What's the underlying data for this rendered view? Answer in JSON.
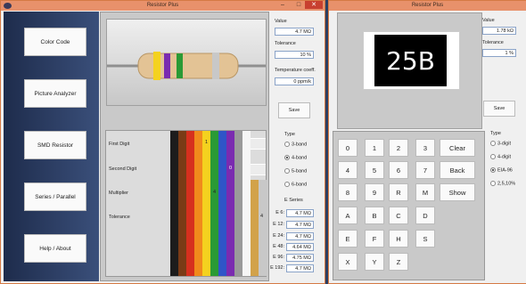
{
  "window1": {
    "title": "Resistor Plus",
    "nav": [
      "Color Code",
      "Picture Analyzer",
      "SMD Resistor",
      "Series / Parallel",
      "Help / About"
    ],
    "rows": [
      "First Digit",
      "Second Digit",
      "Multiplier",
      "Tolerance"
    ],
    "markers": [
      "1",
      "0",
      "4",
      "4"
    ],
    "value_label": "Value",
    "value": "4.7 MΩ",
    "tolerance_label": "Tolerance",
    "tolerance": "10 %",
    "tempco_label": "Temperature coeff.",
    "tempco": "0 ppm/k",
    "save": "Save",
    "type_label": "Type",
    "types": [
      "3-band",
      "4-band",
      "5-band",
      "6-band"
    ],
    "selected_type": "4-band",
    "eseries_label": "E Series",
    "eseries": [
      {
        "name": "E 6:",
        "value": "4.7 MΩ"
      },
      {
        "name": "E 12:",
        "value": "4.7 MΩ"
      },
      {
        "name": "E 24:",
        "value": "4.7 MΩ"
      },
      {
        "name": "E 48:",
        "value": "4.64 MΩ"
      },
      {
        "name": "E 96:",
        "value": "4.75 MΩ"
      },
      {
        "name": "E 192:",
        "value": "4.7 MΩ"
      }
    ],
    "colors": {
      "black": "#1c1c1c",
      "brown": "#7a3b16",
      "red": "#d6301e",
      "orange": "#f08a1c",
      "yellow": "#f4d21f",
      "green": "#2a9a35",
      "blue": "#2f55c8",
      "violet": "#7a2bb0",
      "grey": "#9a9a9a",
      "white": "#f6f6f6",
      "gold": "#d2a24a",
      "silver": "#c8c8c8",
      "body": "#e3c395"
    }
  },
  "window2": {
    "title": "Resistor Plus",
    "smd_code": "25B",
    "value_label": "Value",
    "value": "1.78 kΩ",
    "tolerance_label": "Tolerance",
    "tolerance": "1 %",
    "save": "Save",
    "type_label": "Type",
    "types": [
      "3-digit",
      "4-digit",
      "EIA-96",
      "2,5,10%"
    ],
    "selected_type": "EIA-96",
    "keys": [
      [
        "0",
        "1",
        "2",
        "3"
      ],
      [
        "4",
        "5",
        "6",
        "7"
      ],
      [
        "8",
        "9",
        "R",
        "M"
      ],
      [
        "A",
        "B",
        "C",
        "D"
      ],
      [
        "E",
        "F",
        "H",
        "S"
      ],
      [
        "X",
        "Y",
        "Z"
      ]
    ],
    "actions": [
      "Clear",
      "Back",
      "Show"
    ]
  }
}
